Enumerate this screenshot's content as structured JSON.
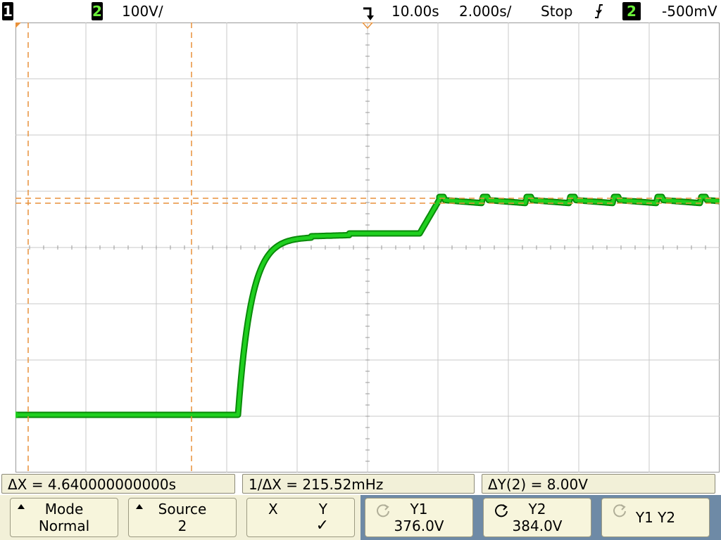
{
  "status": {
    "ch1": "1",
    "ch2": "2",
    "volts_per_div": "100V/",
    "time_reference": "10.00s",
    "time_per_div": "2.000s/",
    "run_state": "Stop",
    "trigger_source": "2",
    "trigger_level": "-500mV"
  },
  "trace": {
    "channel_marker": "2",
    "color": "#1fd01f",
    "cursor_color": "#e8913a"
  },
  "measurements": {
    "delta_x": "ΔX = 4.640000000000s",
    "inverse_delta_x": "1/ΔX = 215.52mHz",
    "delta_y": "ΔY(2) = 8.00V"
  },
  "softkeys": {
    "mode": {
      "label": "Mode",
      "value": "Normal"
    },
    "source": {
      "label": "Source",
      "value": "2"
    },
    "xy": {
      "x": "X",
      "y": "Y",
      "selected": "✓"
    },
    "y1": {
      "label": "Y1",
      "value": "376.0V"
    },
    "y2": {
      "label": "Y2",
      "value": "384.0V"
    },
    "y1y2": {
      "label": "Y1 Y2"
    }
  },
  "colors": {
    "softkey_bg": "#f7f5dc",
    "active_group": "#6e8aa6",
    "grid": "#c8c8c8"
  }
}
